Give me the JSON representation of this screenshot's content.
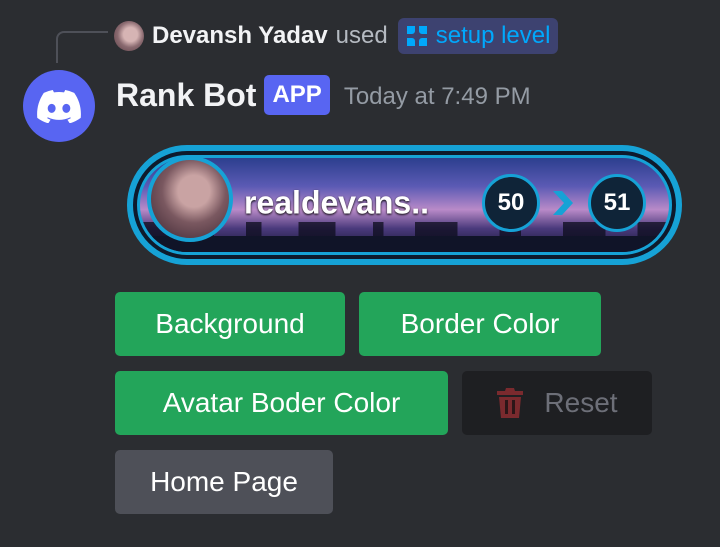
{
  "reply": {
    "username": "Devansh Yadav",
    "used_text": "used",
    "command": "setup level"
  },
  "message": {
    "bot_name": "Rank Bot",
    "app_tag": "APP",
    "timestamp": "Today at 7:49 PM"
  },
  "rank_card": {
    "username": "realdevans..",
    "from_level": "50",
    "to_level": "51"
  },
  "buttons": {
    "background": "Background",
    "border_color": "Border Color",
    "avatar_border_color": "Avatar Boder Color",
    "reset": "Reset",
    "home_page": "Home Page"
  },
  "colors": {
    "background": "#2b2d31",
    "blurple": "#5865f2",
    "success_green": "#23a55a",
    "card_accent": "#16a2d6",
    "command_link": "#00a8fc"
  },
  "icons": {
    "bot_avatar": "discord-logo-icon",
    "command": "app-command-icon",
    "reset": "trash-icon",
    "level_arrow": "chevron-right-icon"
  }
}
